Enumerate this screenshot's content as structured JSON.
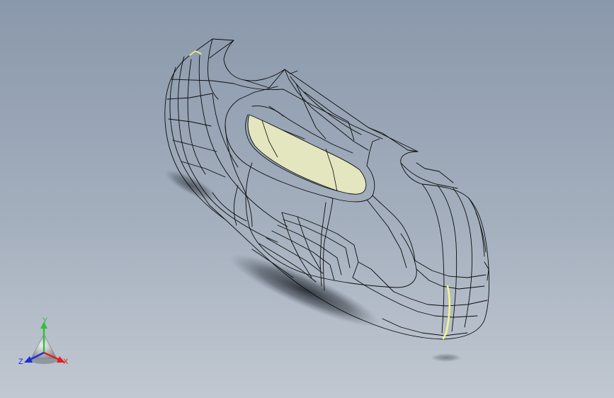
{
  "triad": {
    "y_label": "Y",
    "z_label": "Z",
    "x_label": "X",
    "y_color": "#2fbf3a",
    "z_color": "#1a2fd6",
    "x_color": "#e02020"
  },
  "colors": {
    "background_top": "#8a98ab",
    "background_bottom": "#c1c8d1",
    "wire": "#0b0b0b",
    "highlight_face": "#e3e6be",
    "selected_edge": "#f3f58a"
  },
  "icons": {
    "model": "car-body-wireframe-icon",
    "triad": "axis-triad-icon"
  }
}
